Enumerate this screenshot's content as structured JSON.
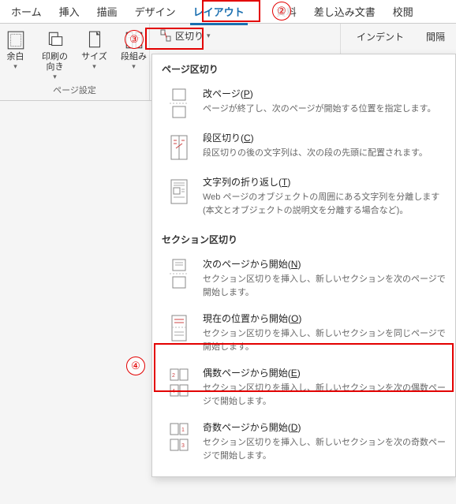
{
  "tabs": {
    "home": "ホーム",
    "insert": "挿入",
    "draw": "描画",
    "design": "デザイン",
    "layout": "レイアウト",
    "references_suffix": "資料",
    "mailings": "差し込み文書",
    "review": "校閲"
  },
  "ribbon": {
    "margins": "余白",
    "orientation": "印刷の\n向き",
    "size": "サイズ",
    "columns": "段組み",
    "group_page_setup": "ページ設定",
    "breaks": "区切り",
    "indent": "インデント",
    "spacing": "間隔"
  },
  "dropdown": {
    "section_page": "ページ区切り",
    "items_page": [
      {
        "title_pre": "改ページ(",
        "hotkey": "P",
        "title_post": ")",
        "desc": "ページが終了し、次のページが開始する位置を指定します。"
      },
      {
        "title_pre": "段区切り(",
        "hotkey": "C",
        "title_post": ")",
        "desc": "段区切りの後の文字列は、次の段の先頭に配置されます。"
      },
      {
        "title_pre": "文字列の折り返し(",
        "hotkey": "T",
        "title_post": ")",
        "desc": "Web ページのオブジェクトの周囲にある文字列を分離します (本文とオブジェクトの説明文を分離する場合など)。"
      }
    ],
    "section_section": "セクション区切り",
    "items_section": [
      {
        "title_pre": "次のページから開始(",
        "hotkey": "N",
        "title_post": ")",
        "desc": "セクション区切りを挿入し、新しいセクションを次のページで開始します。"
      },
      {
        "title_pre": "現在の位置から開始(",
        "hotkey": "O",
        "title_post": ")",
        "desc": "セクション区切りを挿入し、新しいセクションを同じページで開始します。"
      },
      {
        "title_pre": "偶数ページから開始(",
        "hotkey": "E",
        "title_post": ")",
        "desc": "セクション区切りを挿入し、新しいセクションを次の偶数ページで開始します。"
      },
      {
        "title_pre": "奇数ページから開始(",
        "hotkey": "D",
        "title_post": ")",
        "desc": "セクション区切りを挿入し、新しいセクションを次の奇数ページで開始します。"
      }
    ]
  },
  "annotations": {
    "a2": "②",
    "a3": "③",
    "a4": "④"
  }
}
